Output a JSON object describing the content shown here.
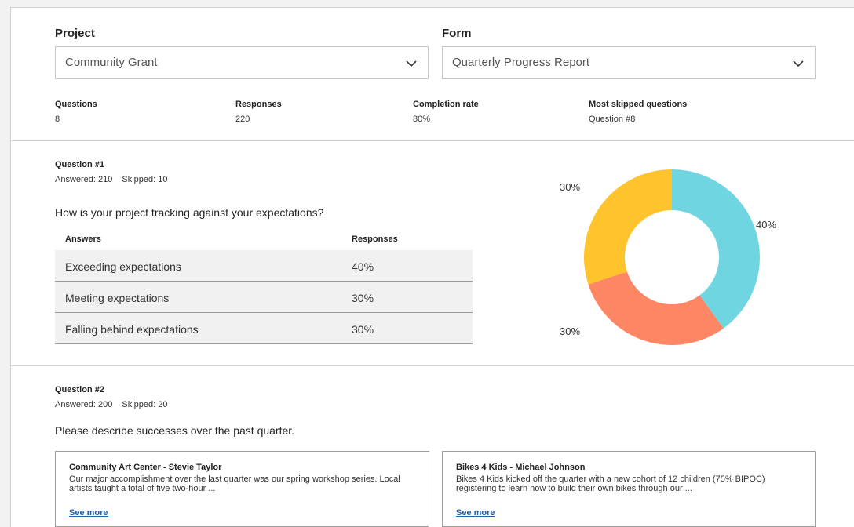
{
  "filters": {
    "project_label": "Project",
    "project_value": "Community Grant",
    "form_label": "Form",
    "form_value": "Quarterly Progress Report"
  },
  "stats": [
    {
      "label": "Questions",
      "value": "8"
    },
    {
      "label": "Responses",
      "value": "220"
    },
    {
      "label": "Completion rate",
      "value": "80%"
    },
    {
      "label": "Most skipped questions",
      "value": "Question #8"
    }
  ],
  "question1": {
    "title": "Question #1",
    "answered": "Answered: 210",
    "skipped": "Skipped: 10",
    "text": "How is your project tracking against your expectations?",
    "answers_header": "Answers",
    "responses_header": "Responses",
    "rows": [
      {
        "answer": "Exceeding expectations",
        "response": "40%"
      },
      {
        "answer": "Meeting expectations",
        "response": "30%"
      },
      {
        "answer": "Falling behind expectations",
        "response": "30%"
      }
    ]
  },
  "chart_data": {
    "type": "pie",
    "donut": true,
    "categories": [
      "Exceeding expectations",
      "Meeting expectations",
      "Falling behind expectations"
    ],
    "values": [
      40,
      30,
      30
    ],
    "data_labels": [
      "40%",
      "30%",
      "30%"
    ],
    "colors": [
      "#6fd5e0",
      "#fd8764",
      "#ffc42d"
    ]
  },
  "question2": {
    "title": "Question #2",
    "answered": "Answered: 200",
    "skipped": "Skipped: 20",
    "text": "Please describe successes over the past quarter.",
    "cards": [
      {
        "title": "Community Art Center - Stevie Taylor",
        "body": "Our major accomplishment over the last quarter was our spring workshop series. Local artists taught a total of five two-hour ...",
        "link": "See more"
      },
      {
        "title": "Bikes 4 Kids - Michael Johnson",
        "body": "Bikes 4 Kids kicked off the quarter with a new cohort of 12 children (75% BIPOC) registering to learn how to build their own bikes through our ...",
        "link": "See more"
      }
    ]
  },
  "icons": {
    "dropdown": "chevron-down-icon"
  }
}
